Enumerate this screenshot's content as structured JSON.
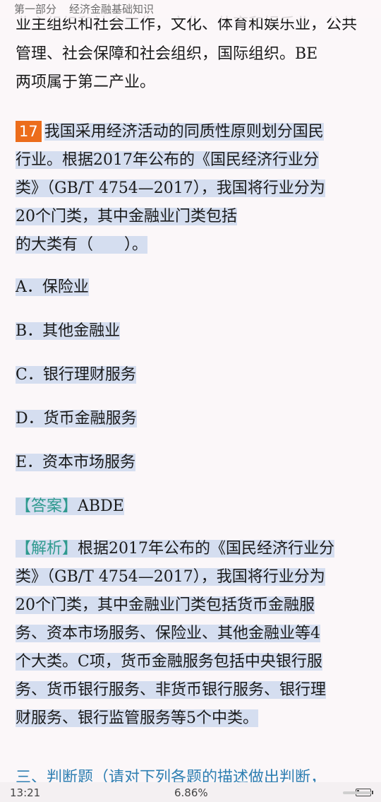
{
  "header": {
    "part": "第一部分",
    "book": "经济金融基础知识"
  },
  "top_partial": "业主组织和社会工作，文化、体育和娱乐业，公共",
  "prev_lines": [
    "管理、社会保障和社会组织，国际组织。BE",
    "两项属于第二产业。"
  ],
  "question": {
    "number": "17",
    "lines": [
      "我国采用经济活动的同质性原则划分国民",
      "行业。根据2017年公布的《国民经济行业分",
      "类》（GB/T 4754—2017），我国将行业分为",
      "20个门类，其中金融业门类包括",
      "的大类有（　　）。"
    ]
  },
  "options": [
    "A．保险业",
    "B．其他金融业",
    "C．银行理财服务",
    "D．货币金融服务",
    "E．资本市场服务"
  ],
  "answer": {
    "label": "【答案】",
    "value": "ABDE"
  },
  "analysis": {
    "label": "【解析】",
    "lines": [
      "根据2017年公布的《国民经济行业分",
      "类》（GB/T 4754—2017），我国将行业分为",
      "20个门类，其中金融业门类包括货币金融服",
      "务、资本市场服务、保险业、其他金融业等4",
      "个大类。C项，货币金融服务包括中央银行服",
      "务、货币银行服务、非货币银行服务、银行理",
      "财服务、银行监管服务等5个中类。"
    ]
  },
  "next_section": "三、判断题（请对下列各题的描述做出判断，",
  "status": {
    "time": "13:21",
    "progress": "6.86%",
    "battery_level": 0.15
  },
  "colors": {
    "question_badge": "#ec6d1c",
    "tag": "#2f9a8f",
    "highlight": "#d5def0",
    "section": "#2f7fb2"
  }
}
